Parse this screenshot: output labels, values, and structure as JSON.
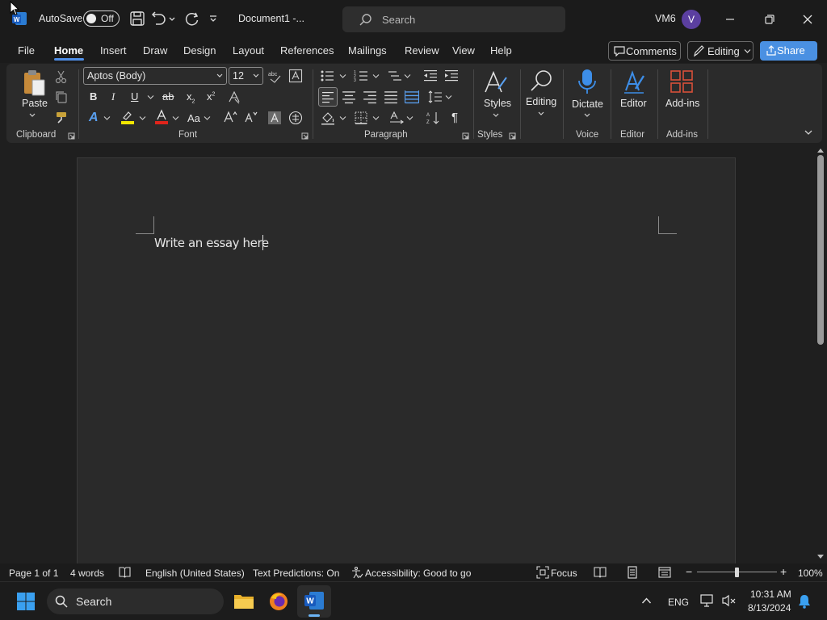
{
  "titlebar": {
    "autosave_label": "AutoSave",
    "autosave_state": "Off",
    "doc_title": "Document1  -...",
    "search_placeholder": "Search",
    "user_name": "VM6",
    "avatar_initial": "V"
  },
  "menu": {
    "tabs": [
      "File",
      "Home",
      "Insert",
      "Draw",
      "Design",
      "Layout",
      "References",
      "Mailings",
      "Review",
      "View",
      "Help"
    ],
    "active_tab": "Home",
    "comments_label": "Comments",
    "editing_label": "Editing",
    "share_label": "Share"
  },
  "ribbon": {
    "clipboard": {
      "paste_label": "Paste",
      "group_label": "Clipboard"
    },
    "font": {
      "font_name": "Aptos (Body)",
      "font_size": "12",
      "group_label": "Font",
      "bold": "B",
      "italic": "I",
      "underline": "U",
      "strike": "ab",
      "sub": "x",
      "sup": "x",
      "case": "Aa"
    },
    "paragraph": {
      "group_label": "Paragraph"
    },
    "styles": {
      "label": "Styles",
      "group_label": "Styles"
    },
    "editing": {
      "label": "Editing"
    },
    "voice": {
      "dictate_label": "Dictate",
      "group_label": "Voice"
    },
    "editor": {
      "label": "Editor",
      "group_label": "Editor"
    },
    "addins": {
      "label": "Add-ins",
      "group_label": "Add-ins"
    }
  },
  "document": {
    "body_text": "Write an essay here"
  },
  "status": {
    "page": "Page 1 of 1",
    "words": "4 words",
    "language": "English (United States)",
    "predictions": "Text Predictions: On",
    "accessibility": "Accessibility: Good to go",
    "focus": "Focus",
    "zoom": "100%"
  },
  "taskbar": {
    "search_placeholder": "Search",
    "lang": "ENG",
    "time": "10:31 AM",
    "date": "8/13/2024"
  },
  "colors": {
    "accent": "#4a90e2",
    "avatar": "#5b3fa0",
    "word_blue": "#185abd"
  }
}
